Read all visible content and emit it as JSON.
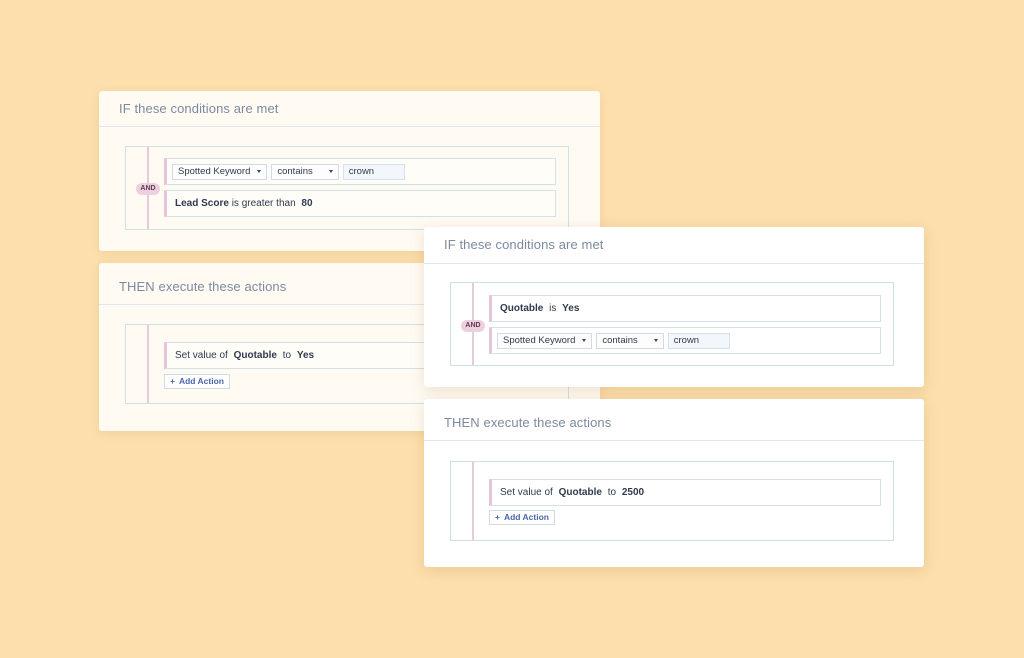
{
  "back_panel": {
    "if_card": {
      "header": "IF these conditions are met",
      "operator": "AND",
      "conditions": [
        {
          "field": "Spotted Keyword",
          "operator": "contains",
          "value": "crown"
        },
        {
          "field": "Lead Score",
          "text": "is greater than",
          "value": "80"
        }
      ]
    },
    "then_card": {
      "header": "THEN execute these actions",
      "actions": [
        {
          "prefix": "Set value of",
          "field": "Quotable",
          "joiner": "to",
          "value": "Yes"
        }
      ],
      "add_action_label": "Add Action",
      "add_action_icon": "+"
    }
  },
  "front_panel": {
    "if_card": {
      "header": "IF these conditions are met",
      "operator": "AND",
      "conditions": [
        {
          "field": "Quotable",
          "text": "is",
          "value": "Yes"
        },
        {
          "field": "Spotted Keyword",
          "operator": "contains",
          "value": "crown"
        }
      ]
    },
    "then_card": {
      "header": "THEN execute these actions",
      "actions": [
        {
          "prefix": "Set value of",
          "field": "Quotable",
          "joiner": "to",
          "value": "2500"
        }
      ],
      "add_action_label": "Add Action",
      "add_action_icon": "+"
    }
  },
  "colors": {
    "background": "#fcdfac",
    "back_card": "#fffbf3",
    "front_card": "#ffffff",
    "rail_pink": "#e9c9dc",
    "link_blue": "#4a66a8"
  }
}
